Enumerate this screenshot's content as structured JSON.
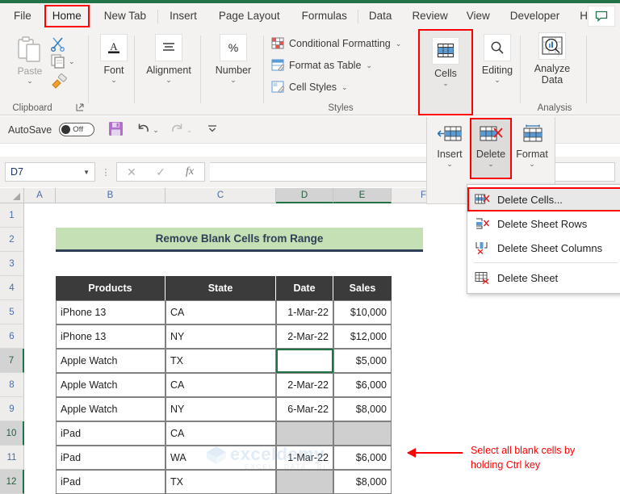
{
  "app": {
    "accent_green": "#217346",
    "highlight_red": "#ff0000"
  },
  "tabs": [
    {
      "label": "File",
      "selected": false
    },
    {
      "label": "Home",
      "selected": true
    },
    {
      "label": "New Tab",
      "selected": false
    },
    {
      "label": "Insert",
      "selected": false
    },
    {
      "label": "Page Layout",
      "selected": false
    },
    {
      "label": "Formulas",
      "selected": false
    },
    {
      "label": "Data",
      "selected": false
    },
    {
      "label": "Review",
      "selected": false
    },
    {
      "label": "View",
      "selected": false
    },
    {
      "label": "Developer",
      "selected": false
    },
    {
      "label": "Help",
      "selected": false
    }
  ],
  "comment_icon": "comment-icon",
  "ribbon": {
    "groups": [
      {
        "name": "Clipboard",
        "label": "Clipboard"
      },
      {
        "name": "Font",
        "label": ""
      },
      {
        "name": "Alignment",
        "label": ""
      },
      {
        "name": "Number",
        "label": ""
      },
      {
        "name": "Styles",
        "label": "Styles"
      },
      {
        "name": "Cells",
        "label": ""
      },
      {
        "name": "Editing",
        "label": ""
      },
      {
        "name": "Analysis",
        "label": "Analysis"
      }
    ],
    "paste_label": "Paste",
    "cut_icon": "scissors-icon",
    "copy_icon": "copy-icon",
    "format_painter_icon": "format-painter-icon",
    "clipboard_launcher_icon": "dialog-launcher-icon",
    "font_label": "Font",
    "font_icon": "font-A-icon",
    "alignment_label": "Alignment",
    "alignment_icon": "alignment-lines-icon",
    "number_label": "Number",
    "number_icon": "percent-icon",
    "styles_items": [
      {
        "label": "Conditional Formatting",
        "icon": "conditional-formatting-icon",
        "caret": true
      },
      {
        "label": "Format as Table",
        "icon": "format-as-table-icon",
        "caret": true
      },
      {
        "label": "Cell Styles",
        "icon": "cell-styles-icon",
        "caret": true
      }
    ],
    "cells_label": "Cells",
    "cells_icon": "cells-table-icon",
    "editing_label": "Editing",
    "editing_icon": "search-magnifier-icon",
    "analyze_label": "Analyze\nData",
    "analyze_label_line1": "Analyze",
    "analyze_label_line2": "Data",
    "analyze_icon": "analyze-data-icon"
  },
  "cells_panel": {
    "insert_label": "Insert",
    "insert_icon": "insert-cells-icon",
    "delete_label": "Delete",
    "delete_icon": "delete-cells-icon",
    "format_label": "Format",
    "format_icon": "format-cells-icon"
  },
  "delete_menu": {
    "items": [
      {
        "label": "Delete Cells...",
        "icon": "delete-cells-icon",
        "active": true
      },
      {
        "label": "Delete Sheet Rows",
        "icon": "delete-rows-icon",
        "active": false
      },
      {
        "label": "Delete Sheet Columns",
        "icon": "delete-columns-icon",
        "active": false
      },
      {
        "label": "Delete Sheet",
        "icon": "delete-sheet-icon",
        "active": false
      }
    ]
  },
  "quick_access": {
    "autosave_label": "AutoSave",
    "autosave_state": "Off",
    "save_icon": "save-disk-icon",
    "undo_icon": "undo-arrow-icon",
    "redo_icon": "redo-arrow-icon",
    "more_icon": "more-commands-icon"
  },
  "formula_bar": {
    "name_box_value": "D7",
    "name_box_caret": "chevron-down-icon",
    "cancel_icon": "cancel-x-icon",
    "enter_icon": "enter-check-icon",
    "function_icon": "insert-function-fx-icon",
    "formula_value": ""
  },
  "sheet": {
    "columns": [
      "A",
      "B",
      "C",
      "D",
      "E",
      "F"
    ],
    "selected_columns": [
      "D",
      "E"
    ],
    "rows": [
      "1",
      "2",
      "3",
      "4",
      "5",
      "6",
      "7",
      "8",
      "9",
      "10",
      "11",
      "12"
    ],
    "selected_rows": [
      "7",
      "10",
      "12"
    ],
    "banner_title": "Remove Blank Cells from Range",
    "table_headers": [
      "Products",
      "State",
      "Date",
      "Sales"
    ],
    "table_rows": [
      {
        "products": "iPhone 13",
        "state": "CA",
        "date": "1-Mar-22",
        "sales": "$10,000",
        "date_blank": false,
        "sales_blank": false,
        "date_active": false
      },
      {
        "products": "iPhone 13",
        "state": "NY",
        "date": "2-Mar-22",
        "sales": "$12,000",
        "date_blank": false,
        "sales_blank": false,
        "date_active": false
      },
      {
        "products": "Apple Watch",
        "state": "TX",
        "date": "",
        "sales": "$5,000",
        "date_blank": true,
        "sales_blank": false,
        "date_active": true
      },
      {
        "products": "Apple Watch",
        "state": "CA",
        "date": "2-Mar-22",
        "sales": "$6,000",
        "date_blank": false,
        "sales_blank": false,
        "date_active": false
      },
      {
        "products": "Apple Watch",
        "state": "NY",
        "date": "6-Mar-22",
        "sales": "$8,000",
        "date_blank": false,
        "sales_blank": false,
        "date_active": false
      },
      {
        "products": "iPad",
        "state": "CA",
        "date": "",
        "sales": "",
        "date_blank": true,
        "sales_blank": true,
        "date_active": false
      },
      {
        "products": "iPad",
        "state": "WA",
        "date": "1-Mar-22",
        "sales": "$6,000",
        "date_blank": false,
        "sales_blank": false,
        "date_active": false
      },
      {
        "products": "iPad",
        "state": "TX",
        "date": "",
        "sales": "$8,000",
        "date_blank": true,
        "sales_blank": false,
        "date_active": false
      }
    ]
  },
  "annotation": {
    "line1": "Select all blank cells by",
    "line2": "holding Ctrl key",
    "arrow_icon": "left-arrow-annotation"
  },
  "watermark": {
    "text": "exceldemy",
    "subtext": "EXCEL · DATA · BI"
  }
}
